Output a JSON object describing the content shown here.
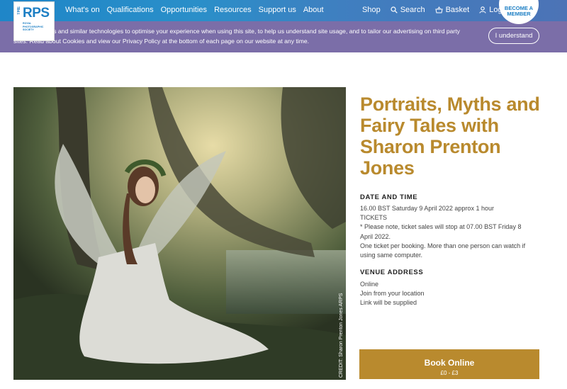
{
  "logo": {
    "the": "THE",
    "rps": "RPS",
    "sub_line1": "ROYAL",
    "sub_line2": "PHOTOGRAPHIC",
    "sub_line3": "SOCIETY"
  },
  "nav": {
    "items": [
      "What's on",
      "Qualifications",
      "Opportunities",
      "Resources",
      "Support us",
      "About"
    ],
    "shop": "Shop",
    "search": "Search",
    "basket": "Basket",
    "login": "Login",
    "member": "BECOME A MEMBER"
  },
  "cookie": {
    "text": "We use cookies and similar technologies to optimise your experience when using this site, to help us understand site usage, and to tailor our advertising on third party sites. Read about Cookies and view our Privacy Policy at the bottom of each page on our website at any time.",
    "button": "I understand"
  },
  "hero": {
    "credit": "CREDIT: Sharon Prenton Jones ARPS"
  },
  "event": {
    "title": "Portraits, Myths and Fairy Tales with Sharon Prenton Jones",
    "date_heading": "DATE AND TIME",
    "date_lines": [
      "16.00 BST Saturday 9 April 2022 approx 1 hour",
      "TICKETS",
      "* Please note, ticket sales will stop at 07.00 BST Friday 8 April 2022.",
      "One ticket per booking. More than one person can watch if using same computer."
    ],
    "venue_heading": "VENUE ADDRESS",
    "venue_lines": [
      "Online",
      "Join from your location",
      "Link will be supplied"
    ],
    "book_label": "Book Online",
    "book_price": "£0 - £3"
  },
  "colors": {
    "accent": "#b98a2e",
    "header": "#1f86c8",
    "cookie": "#7b6ea8"
  }
}
